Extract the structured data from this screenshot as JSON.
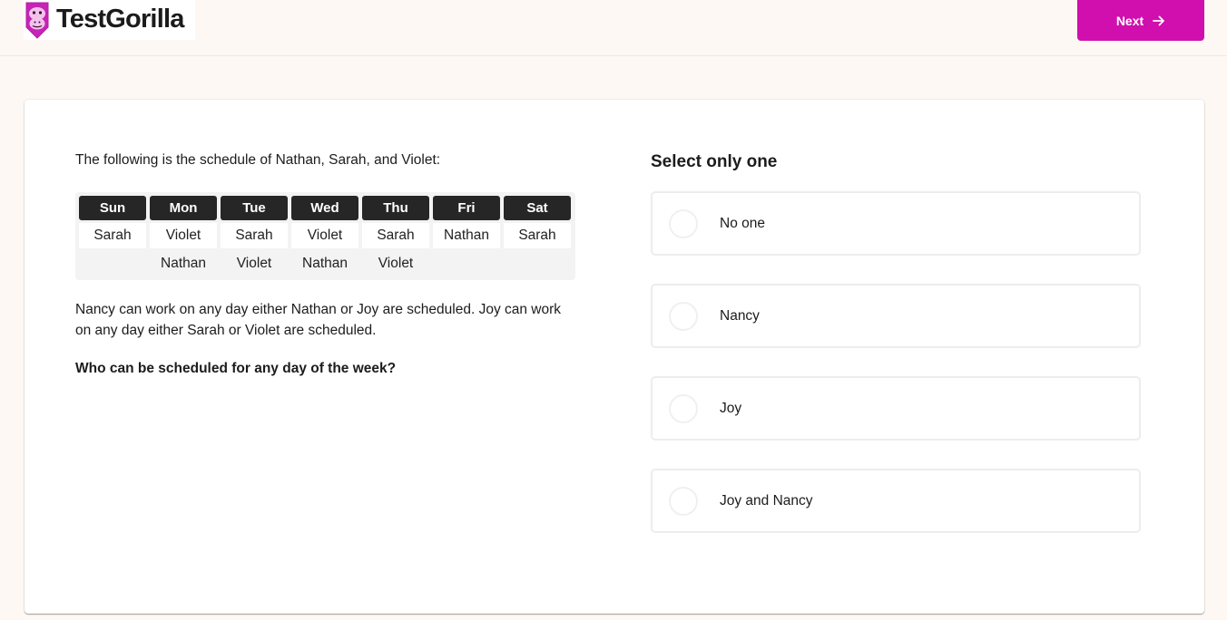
{
  "header": {
    "brand": "TestGorilla",
    "logo_icon": "gorilla-logo-icon",
    "next_label": "Next",
    "next_icon": "arrow-right-icon",
    "accent_color": "#d00fae"
  },
  "question": {
    "intro": "The following is the schedule of Nathan, Sarah, and Violet:",
    "schedule": {
      "days": [
        "Sun",
        "Mon",
        "Tue",
        "Wed",
        "Thu",
        "Fri",
        "Sat"
      ],
      "row1": [
        "Sarah",
        "Violet",
        "Sarah",
        "Violet",
        "Sarah",
        "Nathan",
        "Sarah"
      ],
      "row2": [
        "",
        "Nathan",
        "Violet",
        "Nathan",
        "Violet",
        "",
        ""
      ]
    },
    "rules": "Nancy can work on any day either Nathan or Joy are scheduled. Joy can work on any day either Sarah or Violet are scheduled.",
    "prompt": "Who can be scheduled for any day of the week?"
  },
  "answers": {
    "title": "Select only one",
    "options": [
      {
        "label": "No one",
        "selected": false
      },
      {
        "label": "Nancy",
        "selected": false
      },
      {
        "label": "Joy",
        "selected": false
      },
      {
        "label": "Joy and Nancy",
        "selected": false
      }
    ]
  }
}
